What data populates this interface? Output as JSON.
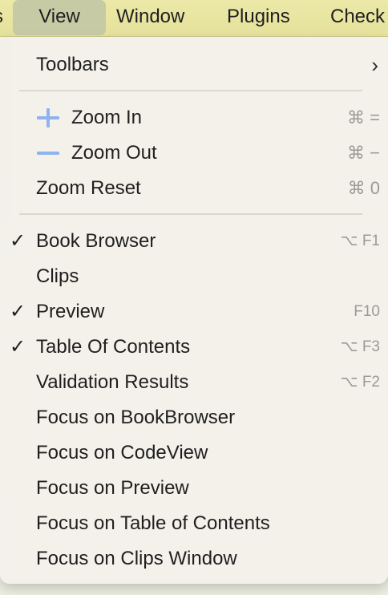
{
  "menubar": {
    "partial_left": "s",
    "view": "View",
    "window": "Window",
    "plugins": "Plugins",
    "check": "Check"
  },
  "menu": {
    "toolbars": {
      "label": "Toolbars",
      "arrow": "›"
    },
    "zoom_in": {
      "label": "Zoom In",
      "shortcut": "⌘ ="
    },
    "zoom_out": {
      "label": "Zoom Out",
      "shortcut": "⌘ −"
    },
    "zoom_reset": {
      "label": "Zoom Reset",
      "shortcut": "⌘ 0"
    },
    "book_browser": {
      "label": "Book Browser",
      "checked": "✓",
      "shortcut": "⌥ F1"
    },
    "clips": {
      "label": "Clips"
    },
    "preview": {
      "label": "Preview",
      "checked": "✓",
      "shortcut": "F10"
    },
    "table_of_contents": {
      "label": "Table Of Contents",
      "checked": "✓",
      "shortcut": "⌥ F3"
    },
    "validation_results": {
      "label": "Validation Results",
      "shortcut": "⌥ F2"
    },
    "focus_bookbrowser": {
      "label": "Focus on BookBrowser"
    },
    "focus_codeview": {
      "label": "Focus on CodeView"
    },
    "focus_preview": {
      "label": "Focus on Preview"
    },
    "focus_toc": {
      "label": "Focus on Table of Contents"
    },
    "focus_clips": {
      "label": "Focus on Clips Window"
    }
  },
  "icons": {
    "zoom_in": "plus-icon",
    "zoom_out": "minus-icon",
    "submenu": "chevron-right-icon",
    "check": "checkmark-icon"
  },
  "colors": {
    "menubar": "#e9e5a2",
    "menu_bg": "#f3f1ea",
    "zoom_icon": "#8fb3ef",
    "shortcut_text": "#9a9a98"
  }
}
